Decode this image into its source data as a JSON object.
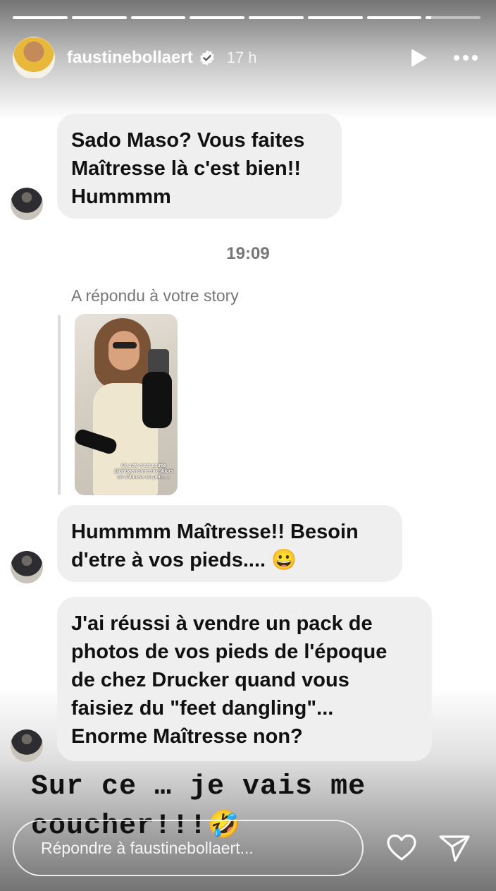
{
  "progress": {
    "segments_total": 8,
    "segments_completed": 7,
    "current_segment_fraction": 0.1
  },
  "header": {
    "username": "faustinebollaert",
    "time": "17 h",
    "verified": true,
    "icons": [
      "play-icon",
      "more-icon"
    ]
  },
  "messages": [
    {
      "text_lines": [
        "Sado Maso? Vous faites",
        "Maîtresse là c'est bien!!",
        "Hummmm"
      ]
    },
    {
      "timestamp": "19:09"
    },
    {
      "replied_label": "A répondu à votre story",
      "story_caption": "Ce soir c'est soirée @bridgertonnetflix! Alors on s'amuse un peu......"
    },
    {
      "text_lines": [
        "Hummmm Maîtresse!! Besoin",
        "d'etre à vos pieds.... 😀"
      ]
    },
    {
      "text_lines": [
        "J'ai réussi à vendre un pack de",
        "photos de vos pieds de l'époque",
        "de chez Drucker quand vous",
        "faisiez du \"feet dangling\"...",
        "Enorme Maîtresse non?"
      ]
    }
  ],
  "overlay": {
    "line1": "Sur ce … je vais me",
    "line2": "coucher!!!",
    "emoji": "🤣"
  },
  "footer": {
    "reply_placeholder": "Répondre à faustinebollaert...",
    "icons": [
      "heart-icon",
      "send-icon"
    ]
  },
  "colors": {
    "bubble": "#efefef",
    "muted_text": "#777777"
  }
}
